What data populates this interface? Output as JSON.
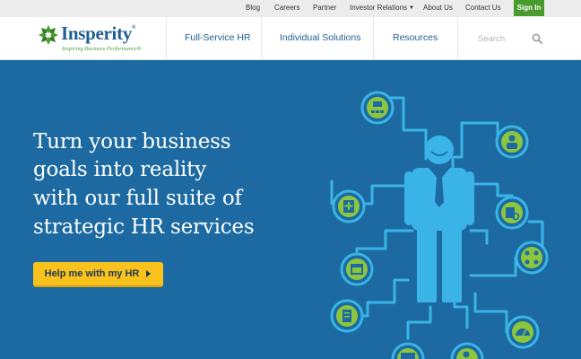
{
  "utility_nav": {
    "blog": "Blog",
    "careers": "Careers",
    "partner": "Partner",
    "investor_relations": "Investor Relations",
    "about_us": "About Us",
    "contact_us": "Contact Us",
    "sign_in": "Sign In"
  },
  "logo": {
    "name": "Insperity",
    "registered": "®",
    "tagline": "Inspiring Business Performance®"
  },
  "main_nav": [
    "Full-Service HR",
    "Individual Solutions",
    "Resources"
  ],
  "search": {
    "placeholder": "Search"
  },
  "hero": {
    "lines": [
      "Turn your business",
      "goals into reality",
      "with our full suite of",
      "strategic HR services"
    ],
    "cta": "Help me with my HR"
  },
  "colors": {
    "brand_blue": "#1c6aa1",
    "hero_blue": "#1c6aa1",
    "brand_green": "#4a9b2e",
    "cta_yellow": "#f9c21d",
    "illustration_cyan": "#3ab4e6",
    "illustration_green": "#8cc63f"
  },
  "icons": {
    "caret": "chevron-down-icon",
    "search": "search-icon",
    "cta_arrow": "triangle-right-icon",
    "illustration": [
      "org-chart-icon",
      "employee-badge-icon",
      "medical-binder-icon",
      "search-people-icon",
      "calendar-icon",
      "network-people-icon",
      "document-icon",
      "dashboard-gauge-icon",
      "certificate-icon",
      "person-award-icon"
    ]
  }
}
